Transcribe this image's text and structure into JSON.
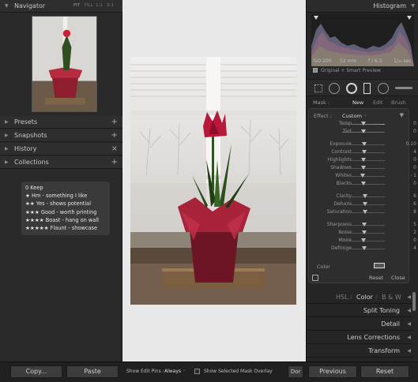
{
  "navigator": {
    "title": "Navigator",
    "zoom_options": [
      "FIT",
      "FILL",
      "1:1",
      "3:1"
    ]
  },
  "left_panels": [
    {
      "title": "Presets",
      "action": "+"
    },
    {
      "title": "Snapshots",
      "action": "+"
    },
    {
      "title": "History",
      "action": "×"
    },
    {
      "title": "Collections",
      "action": "+"
    }
  ],
  "ratings_legend": [
    "0 Keep",
    "★ Hm - something I like",
    "★★ Yes - shows potential",
    "★★★ Good - worth printing",
    "★★★★ Boast - hang on wall",
    "★★★★★ Flaunt - showcase"
  ],
  "left_buttons": {
    "copy": "Copy...",
    "paste": "Paste"
  },
  "toolbar": {
    "show_edit_pins_label": "Show Edit Pins :",
    "show_edit_pins_value": "Always",
    "mask_overlay_label": "Show Selected Mask Overlay",
    "done_label": "Dor"
  },
  "histogram": {
    "title": "Histogram",
    "iso": "ISO 200",
    "focal": "52 mm",
    "aperture": "f / 6.3",
    "shutter": "1/₃₀ sec",
    "preview_label": "Original + Smart Preview"
  },
  "mask": {
    "label": "Mask :",
    "new": "New",
    "edit": "Edit",
    "brush": "Brush",
    "effect_label": "Effect :",
    "effect_value": "Custom",
    "sliders": [
      {
        "label": "Temp",
        "value": "0",
        "pos": 0.5
      },
      {
        "label": "Tint",
        "value": "0",
        "pos": 0.5
      },
      {
        "label": "Exposure",
        "value": "0.10",
        "pos": 0.52
      },
      {
        "label": "Contrast",
        "value": "4",
        "pos": 0.52
      },
      {
        "label": "Highlights",
        "value": "0",
        "pos": 0.5
      },
      {
        "label": "Shadows",
        "value": "0",
        "pos": 0.5
      },
      {
        "label": "Whites",
        "value": "- 1",
        "pos": 0.49
      },
      {
        "label": "Blacks",
        "value": "0",
        "pos": 0.5
      },
      {
        "label": "Clarity",
        "value": "6",
        "pos": 0.53
      },
      {
        "label": "Dehaze",
        "value": "6",
        "pos": 0.53
      },
      {
        "label": "Saturation",
        "value": "8",
        "pos": 0.54
      },
      {
        "label": "Sharpness",
        "value": "5",
        "pos": 0.52
      },
      {
        "label": "Noise",
        "value": "2",
        "pos": 0.51
      },
      {
        "label": "Moire",
        "value": "0",
        "pos": 0.5
      },
      {
        "label": "Defringe",
        "value": "4",
        "pos": 0.52
      }
    ],
    "color_label": "Color",
    "reset": "Reset",
    "close": "Close"
  },
  "right_sections": {
    "hsl": "HSL",
    "color": "Color",
    "bw": "B & W",
    "split_toning": "Split Toning",
    "detail": "Detail",
    "lens": "Lens Corrections",
    "transform": "Transform"
  },
  "right_buttons": {
    "previous": "Previous",
    "reset": "Reset"
  }
}
